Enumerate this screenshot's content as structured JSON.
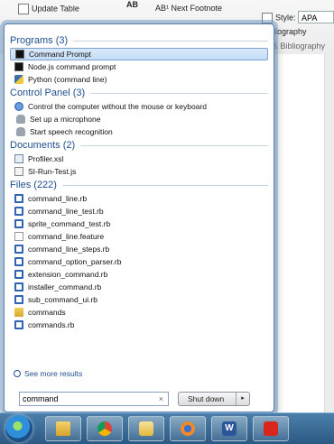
{
  "ribbon": {
    "update_table": "Update Table",
    "ab_label": "AB",
    "next_footnote": "AB¹ Next Footnote",
    "style_label": "Style:",
    "style_value": "APA",
    "bibliography": "Bibliography",
    "citations_group": "ns & Bibliography"
  },
  "start_menu": {
    "groups": {
      "programs": {
        "header": "Programs (3)",
        "items": [
          {
            "label": "Command Prompt",
            "icon": "cmd-icon"
          },
          {
            "label": "Node.js command prompt",
            "icon": "cmd-icon"
          },
          {
            "label": "Python (command line)",
            "icon": "python-icon"
          }
        ]
      },
      "control_panel": {
        "header": "Control Panel (3)",
        "items": [
          {
            "label": "Control the computer without the mouse or keyboard",
            "icon": "ease-of-access-icon"
          },
          {
            "label": "Set up a microphone",
            "icon": "microphone-icon"
          },
          {
            "label": "Start speech recognition",
            "icon": "microphone-icon"
          }
        ]
      },
      "documents": {
        "header": "Documents (2)",
        "items": [
          {
            "label": "Profiler.xsl",
            "icon": "xsl-file-icon"
          },
          {
            "label": "SI-Run-Test.js",
            "icon": "js-file-icon"
          }
        ]
      },
      "files": {
        "header": "Files (222)",
        "items": [
          {
            "label": "command_line.rb",
            "icon": "ruby-file-icon"
          },
          {
            "label": "command_line_test.rb",
            "icon": "ruby-file-icon"
          },
          {
            "label": "sprite_command_test.rb",
            "icon": "ruby-file-icon"
          },
          {
            "label": "command_line.feature",
            "icon": "file-icon"
          },
          {
            "label": "command_line_steps.rb",
            "icon": "ruby-file-icon"
          },
          {
            "label": "command_option_parser.rb",
            "icon": "ruby-file-icon"
          },
          {
            "label": "extension_command.rb",
            "icon": "ruby-file-icon"
          },
          {
            "label": "installer_command.rb",
            "icon": "ruby-file-icon"
          },
          {
            "label": "sub_command_ui.rb",
            "icon": "ruby-file-icon"
          },
          {
            "label": "commands",
            "icon": "folder-icon"
          },
          {
            "label": "commands.rb",
            "icon": "ruby-file-icon"
          }
        ]
      }
    },
    "see_more": "See more results",
    "search": {
      "value": "command",
      "clear": "×"
    },
    "shutdown": {
      "label": "Shut down",
      "arrow": "▸"
    }
  },
  "taskbar": {
    "word_letter": "W"
  }
}
